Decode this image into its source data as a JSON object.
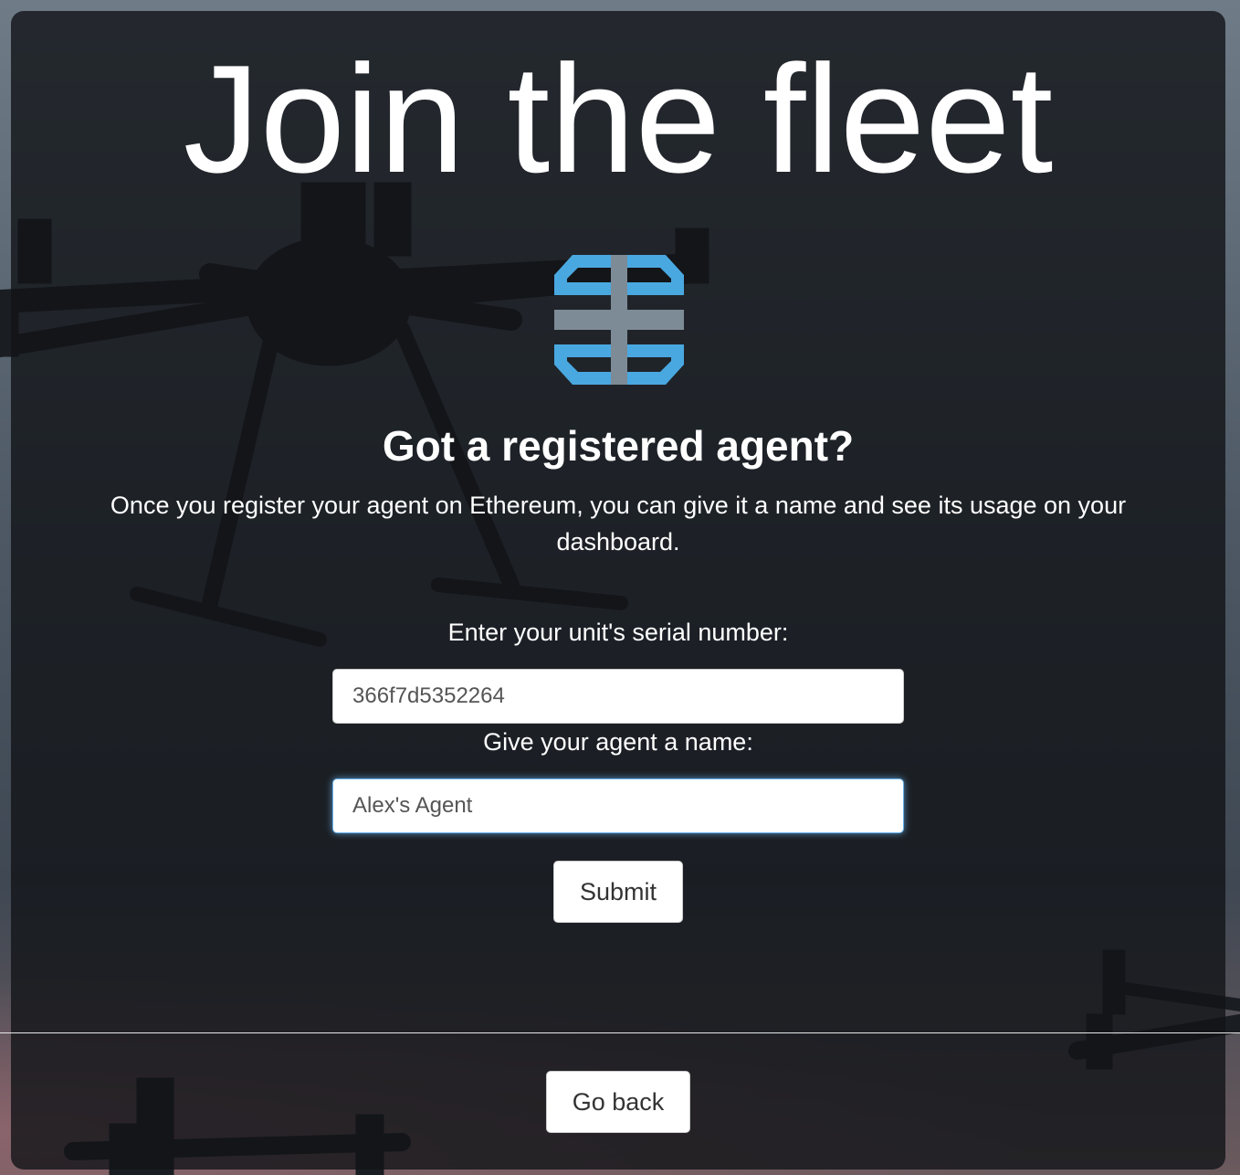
{
  "page": {
    "title": "Join the fleet"
  },
  "logo": {
    "icon": "fleet-logo-icon",
    "colors": {
      "blue": "#4aa8e0",
      "gray": "#7d8b96"
    }
  },
  "registration": {
    "heading": "Got a registered agent?",
    "description": "Once you register your agent on Ethereum, you can give it a name and see its usage on your dashboard.",
    "serial_label": "Enter your unit's serial number:",
    "serial_value": "366f7d5352264",
    "name_label": "Give your agent a name:",
    "name_value": "Alex's Agent",
    "submit_label": "Submit"
  },
  "footer": {
    "back_label": "Go back"
  },
  "colors": {
    "panel": "#121418",
    "text": "#ffffff",
    "focus_ring": "#66afe9"
  }
}
